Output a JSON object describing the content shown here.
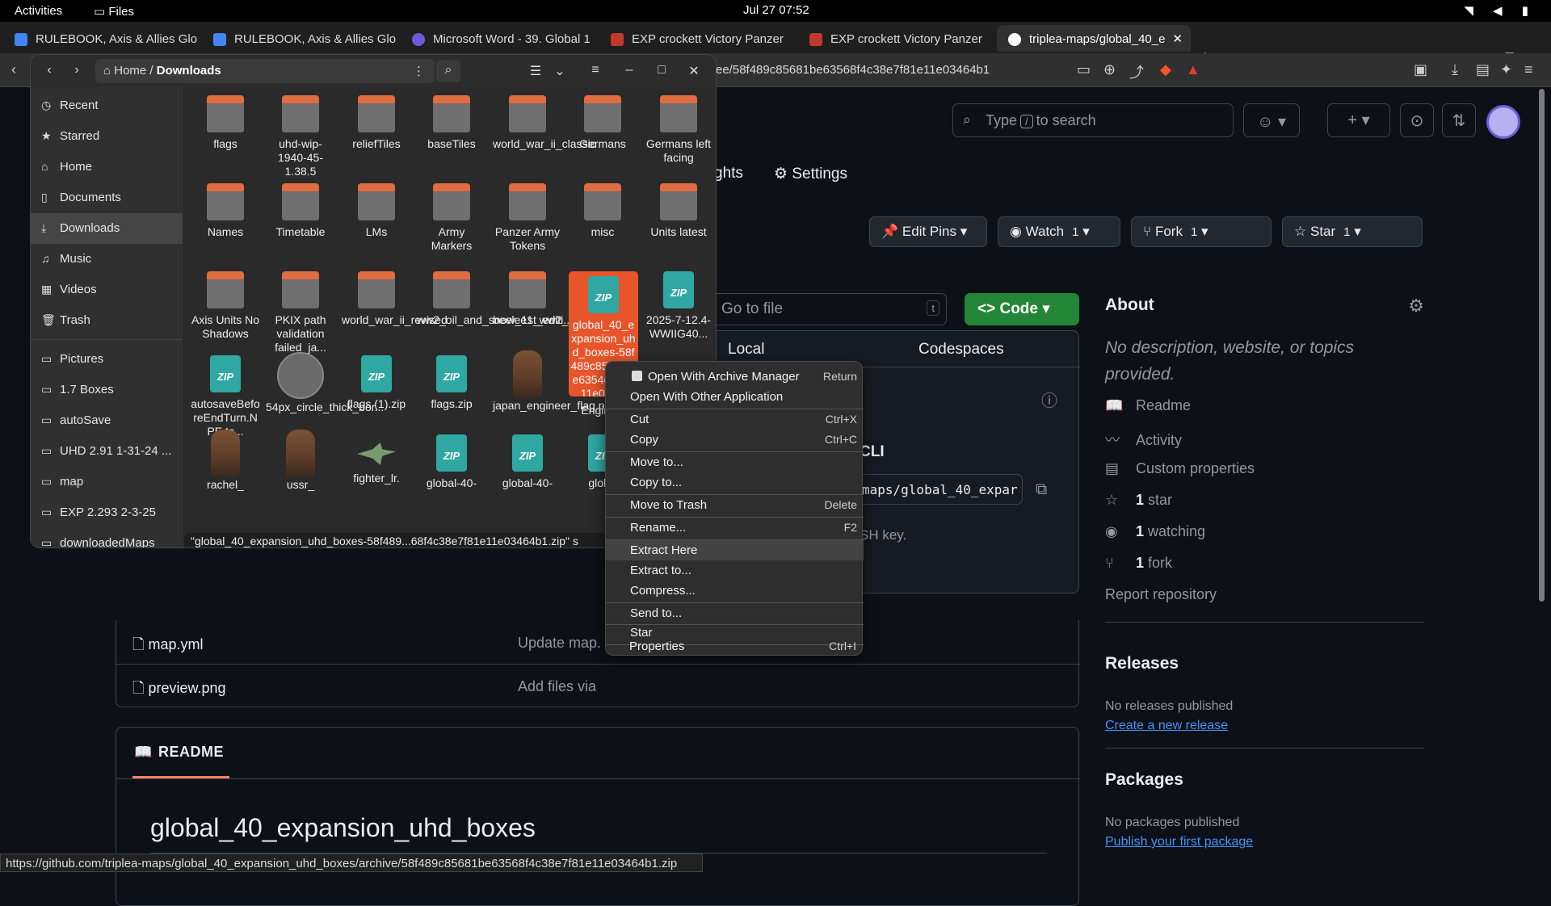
{
  "topbar": {
    "activities": "Activities",
    "files": "Files",
    "clock": "Jul 27  07:52"
  },
  "tabs": [
    {
      "label": "RULEBOOK, Axis & Allies Glo",
      "color": "#4285f4"
    },
    {
      "label": "RULEBOOK, Axis & Allies Glo",
      "color": "#4285f4"
    },
    {
      "label": "Microsoft Word - 39. Global 1",
      "color": "#6b5bd6"
    },
    {
      "label": "EXP crockett Victory Panzer",
      "color": "#c0392b"
    },
    {
      "label": "EXP crockett Victory Panzer",
      "color": "#c0392b"
    },
    {
      "label": "triplea-maps/global_40_e",
      "color": "#ffffff"
    }
  ],
  "url": "ee/58f489c85681be63568f4c38e7f81e11e03464b1",
  "github": {
    "search_prefix": "Type",
    "search_key": "/",
    "search_suffix": "to search",
    "nav_insights": "ghts",
    "nav_settings": "Settings",
    "edit_pins": "Edit Pins",
    "watch": "Watch",
    "watch_count": "1",
    "fork": "Fork",
    "fork_count": "1",
    "star": "Star",
    "star_count": "1",
    "go_to_file": "Go to file",
    "go_key": "t",
    "code": "Code",
    "tab_local": "Local",
    "tab_codespaces": "Codespaces",
    "cli": "CLI",
    "clone_url": "maps/global_40_expar",
    "ssh_note": "SH key.",
    "files": [
      {
        "name": "map.yml",
        "msg": "Update map."
      },
      {
        "name": "preview.png",
        "msg": "Add files via"
      }
    ],
    "readme_label": "README",
    "readme_title": "global_40_expansion_uhd_boxes",
    "about_title": "About",
    "about_desc": "No description, website, or topics provided.",
    "about_items": [
      {
        "icon": "📖",
        "text": "Readme"
      },
      {
        "icon": "〰",
        "text": "Activity"
      },
      {
        "icon": "▤",
        "text": "Custom properties"
      }
    ],
    "stars_n": "1",
    "stars_t": " star",
    "watching_n": "1",
    "watching_t": " watching",
    "forks_n": "1",
    "forks_t": " fork",
    "report": "Report repository",
    "releases": "Releases",
    "no_releases": "No releases published",
    "create_release": "Create a new release",
    "packages": "Packages",
    "no_packages": "No packages published",
    "publish_package": "Publish your first package"
  },
  "status_url": "https://github.com/triplea-maps/global_40_expansion_uhd_boxes/archive/58f489c85681be63568f4c38e7f81e11e03464b1.zip",
  "fm": {
    "path_home": "Home",
    "path_sep": "/",
    "path_current": "Downloads",
    "sidebar": [
      "Recent",
      "Starred",
      "Home",
      "Documents",
      "Downloads",
      "Music",
      "Videos",
      "Trash",
      "Pictures",
      "1.7 Boxes",
      "autoSave",
      "UHD 2.91 1-31-24 ...",
      "map",
      "EXP 2.293 2-3-25",
      "downloadedMaps"
    ],
    "row1": [
      "flags",
      "uhd-wip-1940-45-1.38.5",
      "reliefTiles",
      "baseTiles",
      "world_war_ii_classic",
      "Germans",
      "Germans left facing"
    ],
    "row2": [
      "Names",
      "Timetable",
      "LMs",
      "Army Markers",
      "Panzer Army Tokens",
      "misc",
      "Units latest"
    ],
    "row3": [
      "Axis Units No Shadows",
      "PKIX path validation failed_ja...",
      "world_war_ii_revised",
      "ww2_oil_and_snow_1st_editi...",
      "beelee1_ww2_oil_and_sno...",
      "global_40_expansion_uhd_boxes-58f489c8568 1be6354c38e711e031.z",
      "2025-7-12.4-WWIIG40..."
    ],
    "row4": [
      "autosaveBeforeEndTurn.NPE.ts...",
      "54px_circle_thick_bor...",
      "flags (1).zip",
      "flags.zip",
      "japan_engineer_flag.png",
      "Engin pn"
    ],
    "row5": [
      "rachel_",
      "ussr_",
      "fighter_lr.",
      "global-40-",
      "global-40-",
      "global"
    ],
    "zip_label": "ZIP",
    "status": "\"global_40_expansion_uhd_boxes-58f489...68f4c38e7f81e11e03464b1.zip\" s"
  },
  "menu": [
    {
      "label": "Open With Archive Manager",
      "sc": "Return"
    },
    {
      "label": "Open With Other Application",
      "sc": ""
    },
    {
      "label": "Cut",
      "sc": "Ctrl+X"
    },
    {
      "label": "Copy",
      "sc": "Ctrl+C"
    },
    {
      "label": "Move to...",
      "sc": ""
    },
    {
      "label": "Copy to...",
      "sc": ""
    },
    {
      "label": "Move to Trash",
      "sc": "Delete"
    },
    {
      "label": "Rename...",
      "sc": "F2"
    },
    {
      "label": "Extract Here",
      "sc": ""
    },
    {
      "label": "Extract to...",
      "sc": ""
    },
    {
      "label": "Compress...",
      "sc": ""
    },
    {
      "label": "Send to...",
      "sc": ""
    },
    {
      "label": "Star",
      "sc": ""
    },
    {
      "label": "Properties",
      "sc": "Ctrl+I"
    }
  ]
}
